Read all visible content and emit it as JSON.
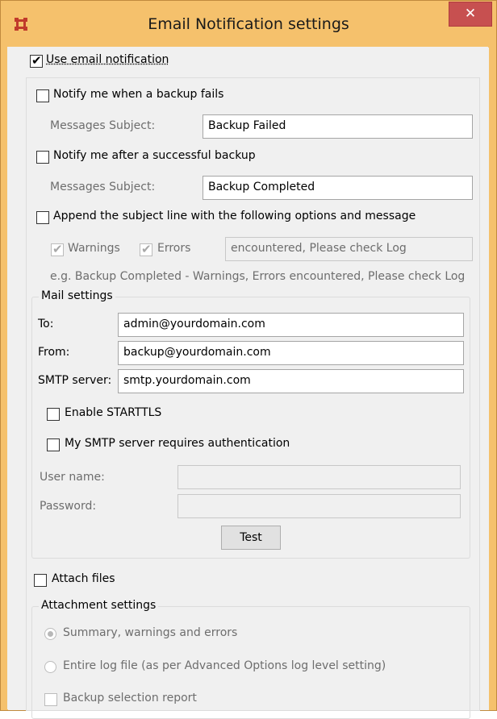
{
  "window": {
    "title": "Email Notification settings",
    "accent_color": "#f5c16c",
    "close_color": "#c75050"
  },
  "use_email": {
    "label": "Use email notification",
    "checked": true
  },
  "notify_fail": {
    "label": "Notify me when a backup fails",
    "checked": false,
    "subject_label": "Messages Subject:",
    "subject_value": "Backup Failed"
  },
  "notify_success": {
    "label": "Notify me after a successful backup",
    "checked": false,
    "subject_label": "Messages Subject:",
    "subject_value": "Backup Completed"
  },
  "append": {
    "label": "Append the subject line with the following options and message",
    "checked": false,
    "warnings_label": "Warnings",
    "warnings_checked": true,
    "errors_label": "Errors",
    "errors_checked": true,
    "message_value": "encountered, Please check Log",
    "example": "e.g. Backup Completed - Warnings, Errors encountered, Please check Log"
  },
  "mail": {
    "group_title": "Mail settings",
    "to_label": "To:",
    "to_value": "admin@yourdomain.com",
    "from_label": "From:",
    "from_value": "backup@yourdomain.com",
    "smtp_label": "SMTP server:",
    "smtp_value": "smtp.yourdomain.com",
    "starttls_label": "Enable STARTTLS",
    "starttls_checked": false,
    "auth_label": "My SMTP server requires authentication",
    "auth_checked": false,
    "username_label": "User name:",
    "username_value": "",
    "password_label": "Password:",
    "password_value": "",
    "test_button": "Test"
  },
  "attach": {
    "label": "Attach files",
    "checked": false
  },
  "attachment": {
    "group_title": "Attachment settings",
    "option_summary": "Summary, warnings and errors",
    "option_entire": "Entire log file (as per Advanced Options log level setting)",
    "selected_option": "Summary, warnings and errors",
    "selection_report_label": "Backup selection report",
    "selection_report_checked": false
  }
}
